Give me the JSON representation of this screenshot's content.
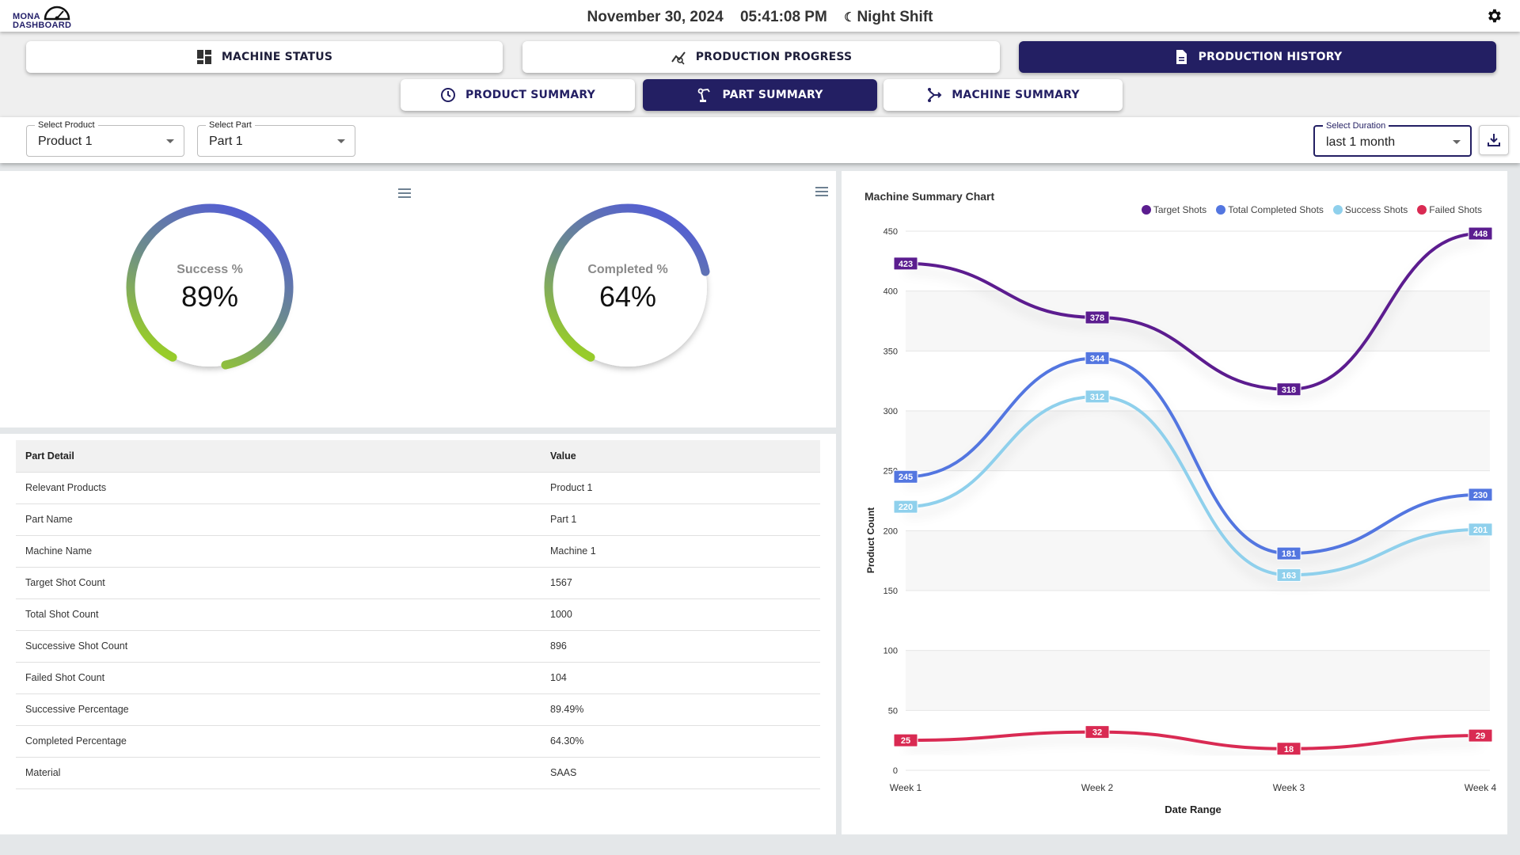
{
  "header": {
    "logo_line1": "MONA",
    "logo_line2": "DASHBOARD",
    "date": "November 30, 2024",
    "time": "05:41:08 PM",
    "shift": "Night Shift"
  },
  "nav": {
    "main_tabs": [
      {
        "label": "MACHINE STATUS",
        "icon": "dashboard-grid-icon",
        "active": false
      },
      {
        "label": "PRODUCTION PROGRESS",
        "icon": "progress-chart-icon",
        "active": false
      },
      {
        "label": "PRODUCTION HISTORY",
        "icon": "document-icon",
        "active": true
      }
    ],
    "sub_tabs": [
      {
        "label": "PRODUCT SUMMARY",
        "icon": "clock-icon",
        "active": false
      },
      {
        "label": "PART SUMMARY",
        "icon": "robot-arm-icon",
        "active": true
      },
      {
        "label": "MACHINE SUMMARY",
        "icon": "machine-icon",
        "active": false
      }
    ]
  },
  "filters": {
    "product": {
      "label": "Select Product",
      "value": "Product 1"
    },
    "part": {
      "label": "Select Part",
      "value": "Part 1"
    },
    "duration": {
      "label": "Select Duration",
      "value": "last 1 month"
    }
  },
  "gauges": [
    {
      "label": "Success %",
      "value_text": "89%",
      "value": 89
    },
    {
      "label": "Completed %",
      "value_text": "64%",
      "value": 64
    }
  ],
  "table": {
    "headers": [
      "Part Detail",
      "Value"
    ],
    "rows": [
      [
        "Relevant Products",
        "Product 1"
      ],
      [
        "Part Name",
        "Part 1"
      ],
      [
        "Machine Name",
        "Machine 1"
      ],
      [
        "Target Shot Count",
        "1567"
      ],
      [
        "Total Shot Count",
        "1000"
      ],
      [
        "Successive Shot Count",
        "896"
      ],
      [
        "Failed Shot Count",
        "104"
      ],
      [
        "Successive Percentage",
        "89.49%"
      ],
      [
        "Completed Percentage",
        "64.30%"
      ],
      [
        "Material",
        "SAAS"
      ]
    ]
  },
  "colors": {
    "primary": "#231f63",
    "target": "#5b1d8f",
    "total": "#5376e0",
    "success": "#8fd0ec",
    "failed": "#d92a52",
    "gauge_start": "#5560d0",
    "gauge_end": "#98cc2a"
  },
  "chart_data": {
    "type": "line",
    "title": "Machine Summary Chart",
    "xlabel": "Date Range",
    "ylabel": "Product Count",
    "categories": [
      "Week 1",
      "Week 2",
      "Week 3",
      "Week 4"
    ],
    "ylim": [
      0,
      450
    ],
    "yticks": [
      0,
      50,
      100,
      150,
      200,
      250,
      300,
      350,
      400,
      450
    ],
    "legend_position": "top-right",
    "series": [
      {
        "name": "Target Shots",
        "color": "#5b1d8f",
        "values": [
          423,
          378,
          318,
          448
        ]
      },
      {
        "name": "Total Completed Shots",
        "color": "#5376e0",
        "values": [
          245,
          344,
          181,
          230
        ]
      },
      {
        "name": "Success Shots",
        "color": "#8fd0ec",
        "values": [
          220,
          312,
          163,
          201
        ]
      },
      {
        "name": "Failed Shots",
        "color": "#d92a52",
        "values": [
          25,
          32,
          18,
          29
        ]
      }
    ]
  }
}
